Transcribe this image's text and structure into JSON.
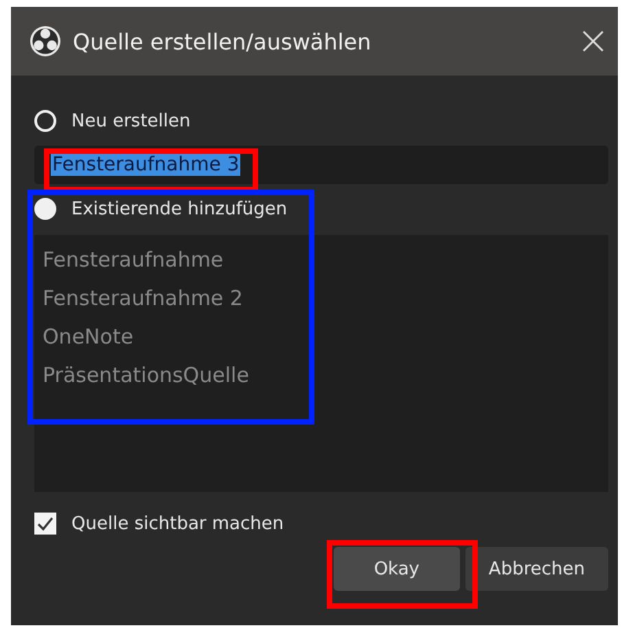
{
  "window": {
    "title": "Quelle erstellen/auswählen"
  },
  "options": [
    {
      "label": "Neu erstellen",
      "selected": false
    },
    {
      "label": "Existierende hinzufügen",
      "selected": true
    }
  ],
  "name_field": {
    "value": "Fensteraufnahme 3",
    "text_selected": true,
    "color": "#ff0000"
  },
  "existing_sources": {
    "disabled": true,
    "color": "#0022ff",
    "items": [
      "Fensteraufnahme",
      "Fensteraufnahme 2",
      "OneNote",
      "PräsentationsQuelle"
    ]
  },
  "visible_checkbox": {
    "label": "Quelle sichtbar machen",
    "checked": true
  },
  "buttons": [
    {
      "label": "Okay",
      "color": "#ff0000"
    },
    {
      "label": "Abbrechen"
    }
  ]
}
